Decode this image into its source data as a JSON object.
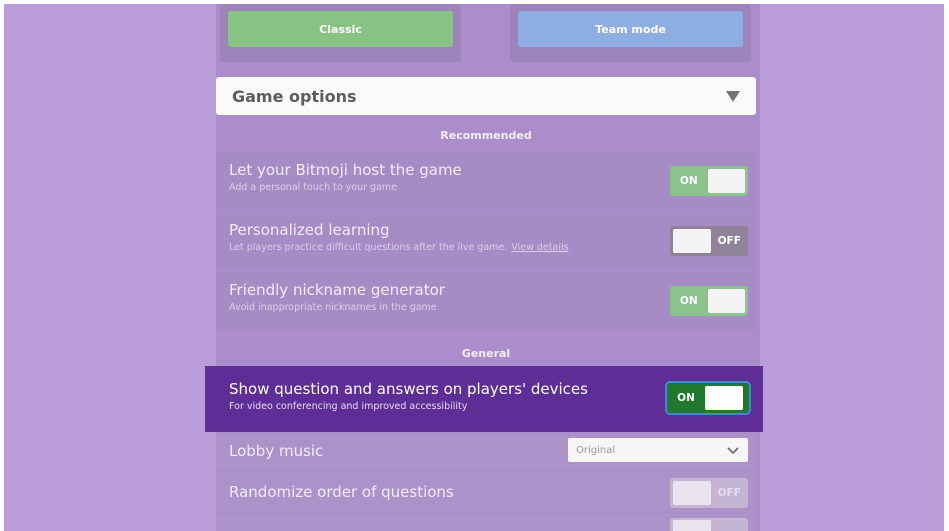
{
  "modes": {
    "classic_label": "Classic",
    "team_label": "Team mode"
  },
  "game_options": {
    "label": "Game options",
    "icon": "triangle-down-icon"
  },
  "sections": {
    "recommended": "Recommended",
    "general": "General"
  },
  "recommended": [
    {
      "title": "Let your Bitmoji host the game",
      "subtitle": "Add a personal touch to your game",
      "toggle": "ON"
    },
    {
      "title": "Personalized learning",
      "subtitle": "Let players practice difficult questions after the live game.",
      "link": "View details",
      "toggle": "OFF"
    },
    {
      "title": "Friendly nickname generator",
      "subtitle": "Avoid inappropriate nicknames in the game",
      "toggle": "ON"
    }
  ],
  "general": {
    "show_questions": {
      "title": "Show question and answers on players' devices",
      "subtitle": "For video conferencing and improved accessibility",
      "toggle": "ON"
    },
    "lobby_music": {
      "title": "Lobby music",
      "value": "Original"
    },
    "randomize_questions": {
      "title": "Randomize order of questions",
      "toggle": "OFF"
    }
  },
  "colors": {
    "background": "#b99cd8",
    "highlight": "#5e2d95",
    "on_toggle": "#8bc48a",
    "classic": "#88c384",
    "team": "#8eaee3"
  }
}
